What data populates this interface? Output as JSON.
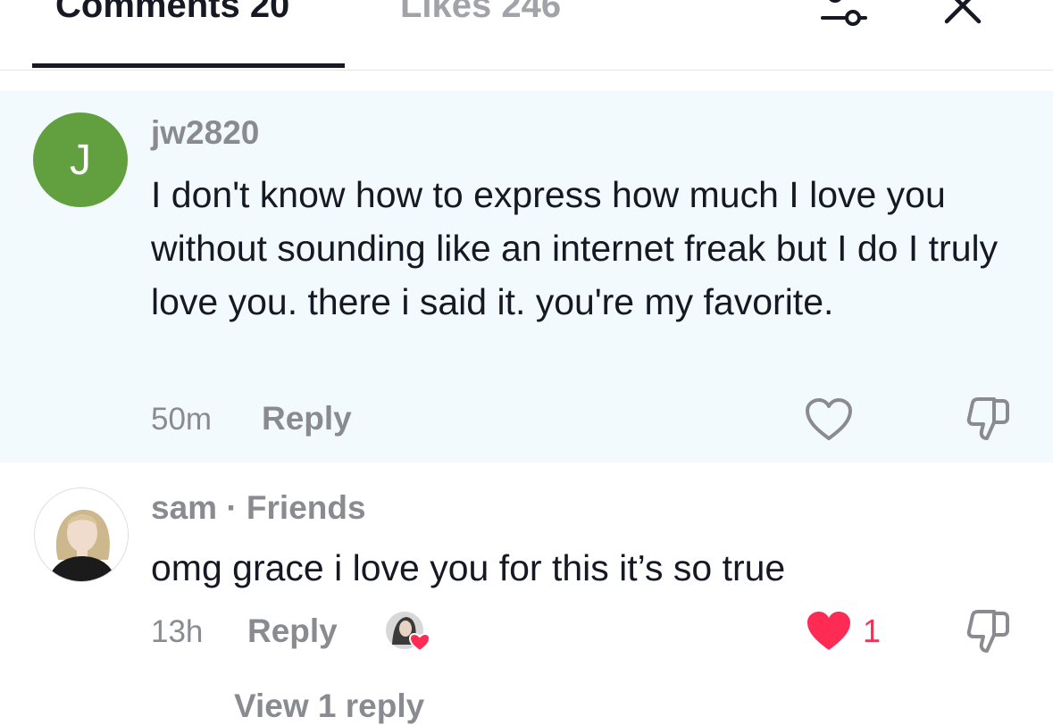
{
  "header": {
    "tab_comments": "Comments 20",
    "tab_likes": "Likes 246",
    "filter_icon": "filter-sliders-icon",
    "close_icon": "close-icon"
  },
  "comments": [
    {
      "avatar_letter": "J",
      "avatar_color": "#62a03f",
      "username": "jw2820",
      "text": "I don't know how to express how much I love you without sounding like an internet freak but I do I truly love you. there i said it. you're my favorite.",
      "time": "50m",
      "reply_label": "Reply",
      "like_icon": "heart-outline-icon",
      "dislike_icon": "dislike-icon",
      "highlighted": true
    },
    {
      "avatar_icon": "user-photo-avatar",
      "username": "sam · Friends",
      "text": "omg grace i love you for this it’s so true",
      "time": "13h",
      "reply_label": "Reply",
      "like_icon": "heart-filled-icon",
      "like_count": "1",
      "creator_like_icon": "creator-liked-icon",
      "dislike_icon": "dislike-icon"
    }
  ],
  "view_replies": "View 1 reply",
  "colors": {
    "highlight_bg": "#f3fafd",
    "accent_red": "#fe2c55",
    "text_primary": "#161823",
    "text_secondary": "#8a8b91"
  }
}
